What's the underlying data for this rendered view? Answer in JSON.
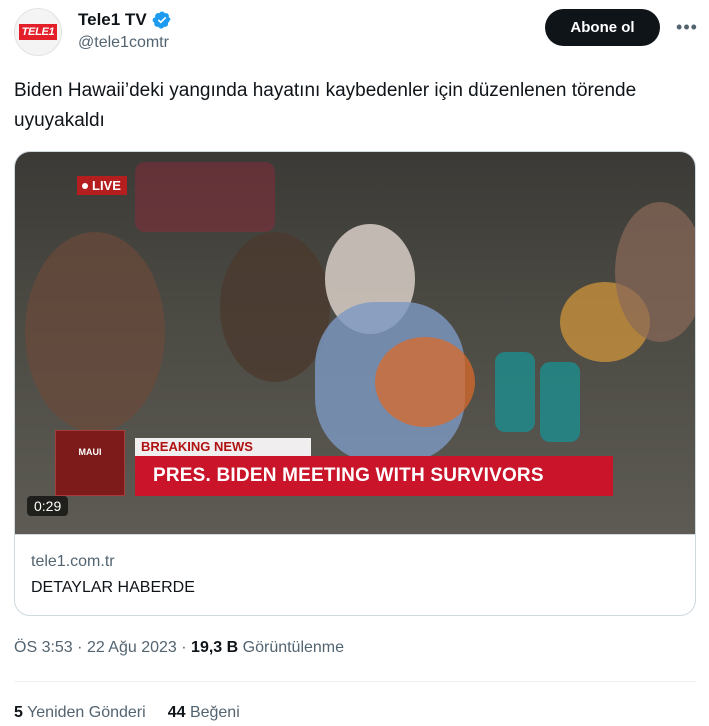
{
  "author": {
    "name": "Tele1 TV",
    "handle": "@tele1comtr",
    "avatar_text": "TELE1",
    "verified_icon": "verified-badge-icon",
    "accent": "#1d9bf0"
  },
  "follow_label": "Abone ol",
  "more_label": "•••",
  "tweet_text": "Biden Hawaii’deki yangında hayatını kaybedenler için düzenlenen törende uyuyakaldı",
  "video": {
    "live_label": "LIVE",
    "maui_label": "MAUI",
    "breaking_label": "BREAKING NEWS",
    "headline": "PRES. BIDEN MEETING WITH SURVIVORS",
    "duration": "0:29"
  },
  "link_card": {
    "domain": "tele1.com.tr",
    "title": "DETAYLAR HABERDE"
  },
  "meta": {
    "time": "ÖS 3:53",
    "date": "22 Ağu 2023",
    "views": "19,3 B",
    "views_label": "Görüntülenme"
  },
  "stats": {
    "retweets": "5",
    "retweets_label": "Yeniden Gönderi",
    "likes": "44",
    "likes_label": "Beğeni"
  }
}
